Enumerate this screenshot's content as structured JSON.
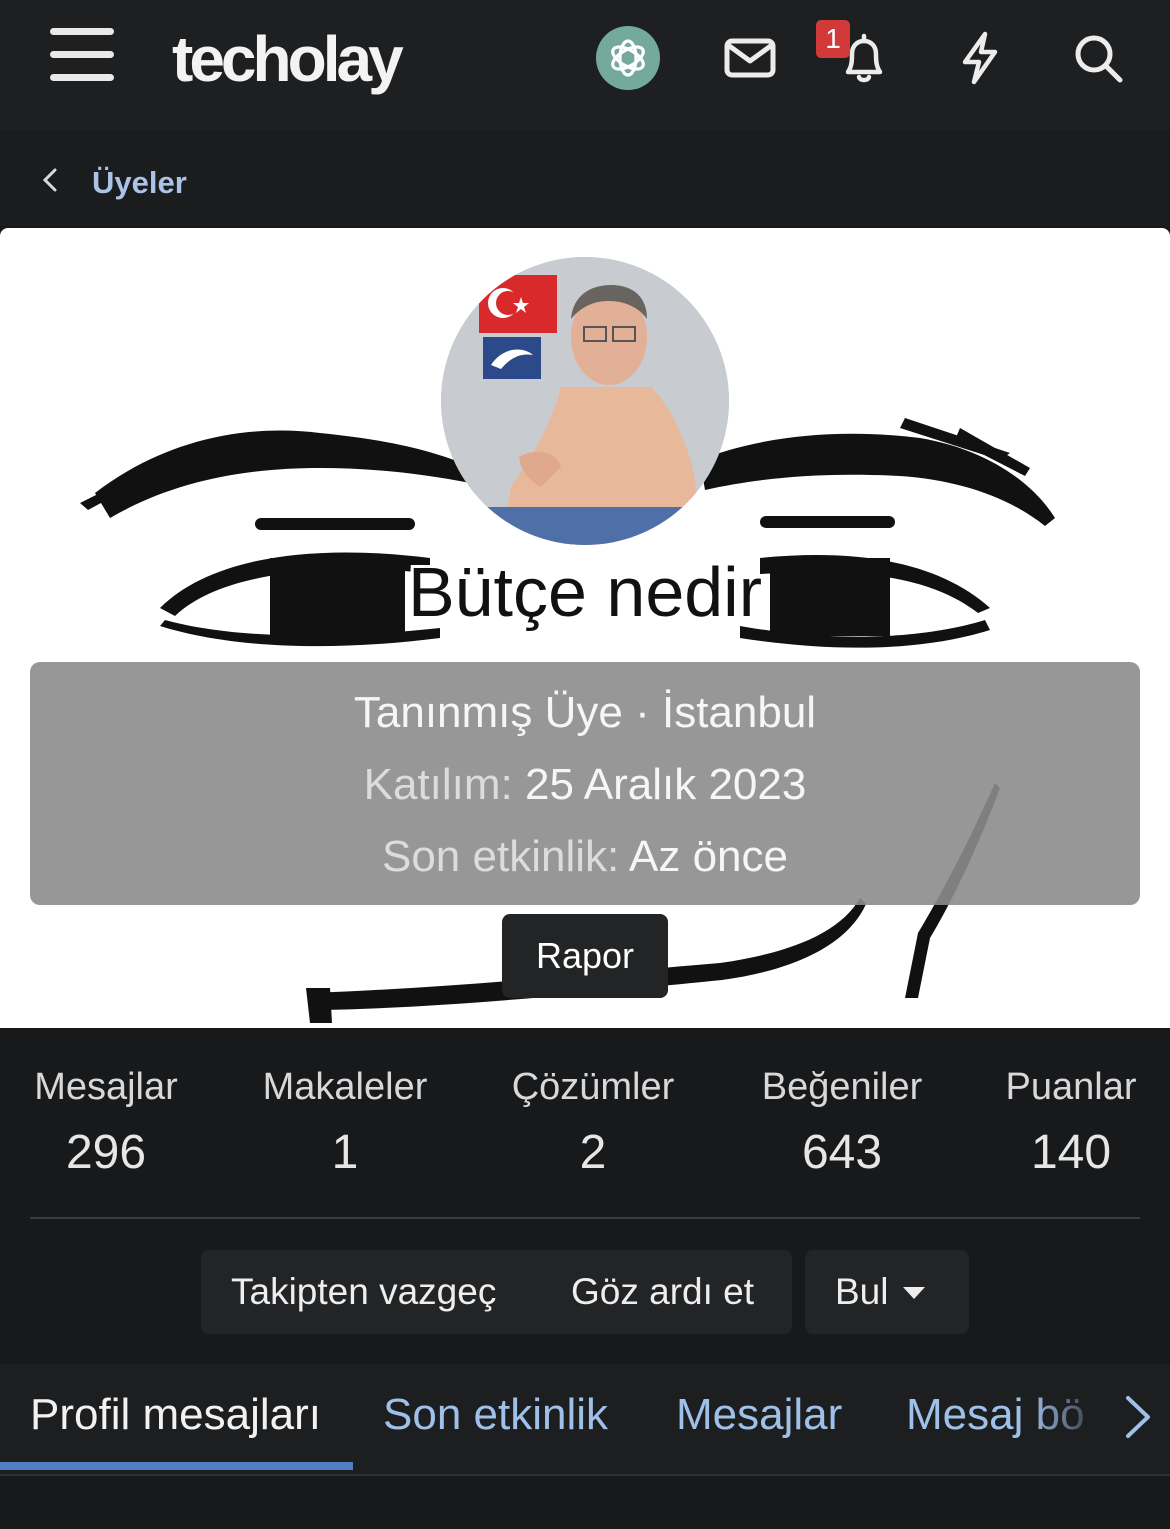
{
  "header": {
    "logo": "techolay",
    "icons": [
      "menu-icon",
      "chatgpt-icon",
      "mail-icon",
      "bell-icon",
      "lightning-icon",
      "search-icon"
    ],
    "notification_count": "1",
    "colors": {
      "bar": "#1e1f21",
      "ai_icon": "#74aa9c",
      "badge": "#d23a3a"
    }
  },
  "breadcrumb": {
    "label": "Üyeler"
  },
  "profile": {
    "username": "Bütçe nedir",
    "title_line": "Tanınmış Üye · İstanbul",
    "joined_label": "Katılım:",
    "joined_value": "25 Aralık 2023",
    "last_activity_label": "Son etkinlik:",
    "last_activity_value": "Az önce",
    "report_button": "Rapor"
  },
  "stats": [
    {
      "label": "Mesajlar",
      "value": "296"
    },
    {
      "label": "Makaleler",
      "value": "1"
    },
    {
      "label": "Çözümler",
      "value": "2"
    },
    {
      "label": "Beğeniler",
      "value": "643"
    },
    {
      "label": "Puanlar",
      "value": "140"
    }
  ],
  "actions": {
    "unfollow": "Takipten vazgeç",
    "ignore": "Göz ardı et",
    "find": "Bul"
  },
  "tabs": [
    {
      "label": "Profil mesajları",
      "active": true
    },
    {
      "label": "Son etkinlik",
      "active": false
    },
    {
      "label": "Mesajlar",
      "active": false
    },
    {
      "label": "Mesaj bö",
      "active": false
    }
  ],
  "accent_color": "#4f7fc1",
  "link_color": "#9fc0e8"
}
